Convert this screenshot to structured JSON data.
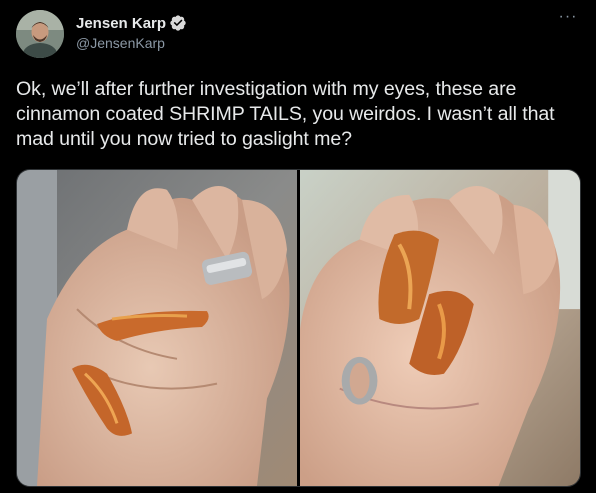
{
  "tweet": {
    "author": {
      "display_name": "Jensen Karp",
      "handle": "@JensenKarp",
      "verified": true,
      "avatar_icon": "profile-avatar"
    },
    "more_icon": "more-options-icon",
    "more_label": "···",
    "text": "Ok, we’ll after further investigation with my eyes, these are cinnamon coated SHRIMP TAILS, you weirdos. I wasn’t all that mad until you now tried to gaslight me?",
    "media": [
      {
        "kind": "photo"
      },
      {
        "kind": "photo"
      }
    ]
  },
  "colors": {
    "background": "#000000",
    "text": "#e7e9ea",
    "secondary": "#8b98a5",
    "verified": "#1d9bf0"
  }
}
